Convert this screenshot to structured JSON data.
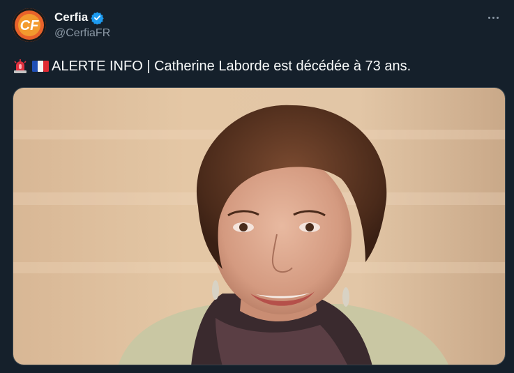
{
  "author": {
    "display_name": "Cerfia",
    "handle": "@CerfiaFR",
    "avatar_text": "CF",
    "verified": true
  },
  "tweet": {
    "emojis": [
      "rotating-light-emoji",
      "france-flag-emoji"
    ],
    "text": "ALERTE INFO | Catherine Laborde est décédée à 73 ans."
  },
  "media": {
    "type": "photo"
  },
  "colors": {
    "background": "#15202b",
    "verified_badge": "#1d9bf0",
    "secondary_text": "#8b98a5",
    "avatar_orange": "#e8622a"
  },
  "icons": [
    "verified-badge-icon",
    "more-options-icon"
  ]
}
